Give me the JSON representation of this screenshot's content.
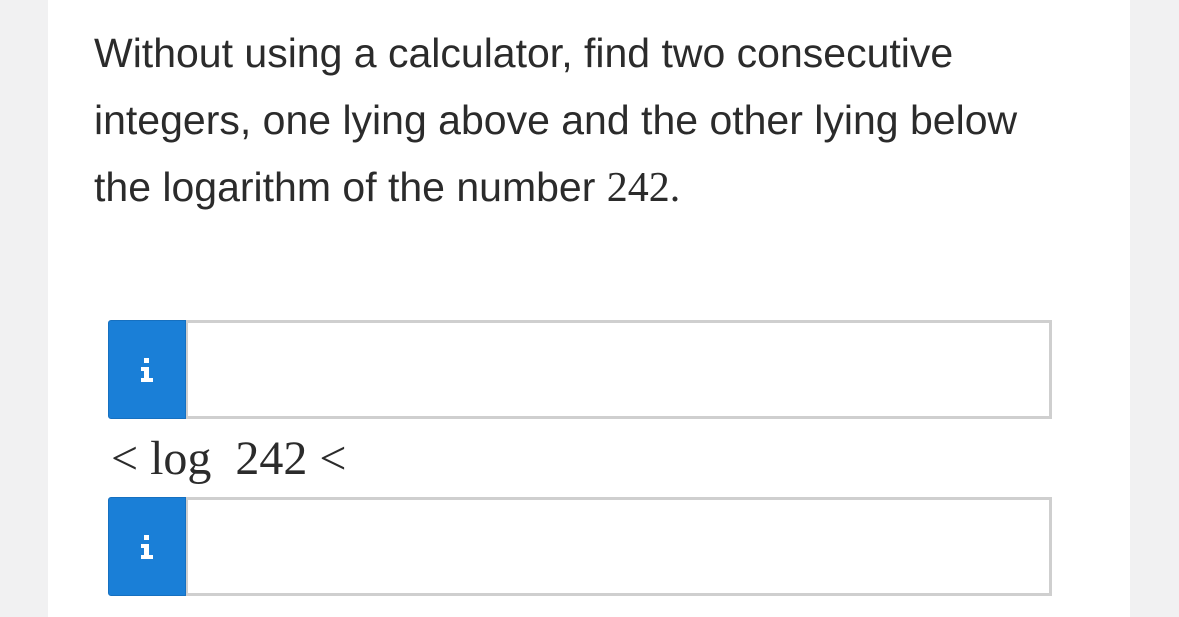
{
  "question": {
    "text_main": "Without using a calculator, find two consecutive integers, one lying above and the other lying below the logarithm of the number ",
    "number": "242."
  },
  "inputs": {
    "lower": {
      "value": "",
      "placeholder": ""
    },
    "upper": {
      "value": "",
      "placeholder": ""
    }
  },
  "info_button": {
    "glyph": "i",
    "icon": "info-icon",
    "color": "#1a7fd7"
  },
  "expression": {
    "left_symbol": "<",
    "middle": " log  242 ",
    "right_symbol": "<"
  }
}
